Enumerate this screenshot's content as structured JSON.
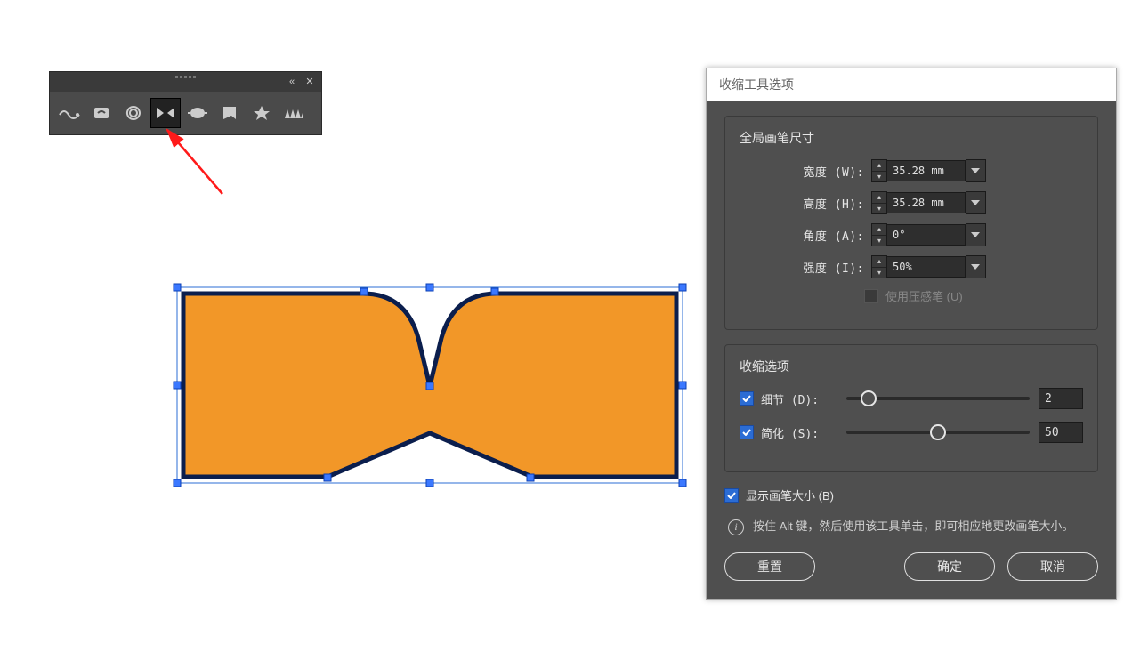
{
  "dialog": {
    "title": "收缩工具选项",
    "group_brush": {
      "title": "全局画笔尺寸",
      "width_label": "宽度 (W):",
      "width_value": "35.28 mm",
      "height_label": "高度 (H):",
      "height_value": "35.28 mm",
      "angle_label": "角度 (A):",
      "angle_value": "0°",
      "intensity_label": "强度 (I):",
      "intensity_value": "50%",
      "pressure_label": "使用压感笔 (U)"
    },
    "group_opts": {
      "title": "收缩选项",
      "detail_label": "细节 (D):",
      "detail_value": "2",
      "simplify_label": "简化 (S):",
      "simplify_value": "50"
    },
    "show_size_label": "显示画笔大小 (B)",
    "hint": "按住 Alt 键，然后使用该工具单击，即可相应地更改画笔大小。",
    "btn_reset": "重置",
    "btn_ok": "确定",
    "btn_cancel": "取消"
  },
  "slider_positions": {
    "detail_pct": 12,
    "simplify_pct": 50
  },
  "colors": {
    "shape_fill": "#f29728",
    "shape_stroke": "#0b1e4d",
    "selection": "#2b6cd4",
    "annotation": "#ff1a1a"
  }
}
